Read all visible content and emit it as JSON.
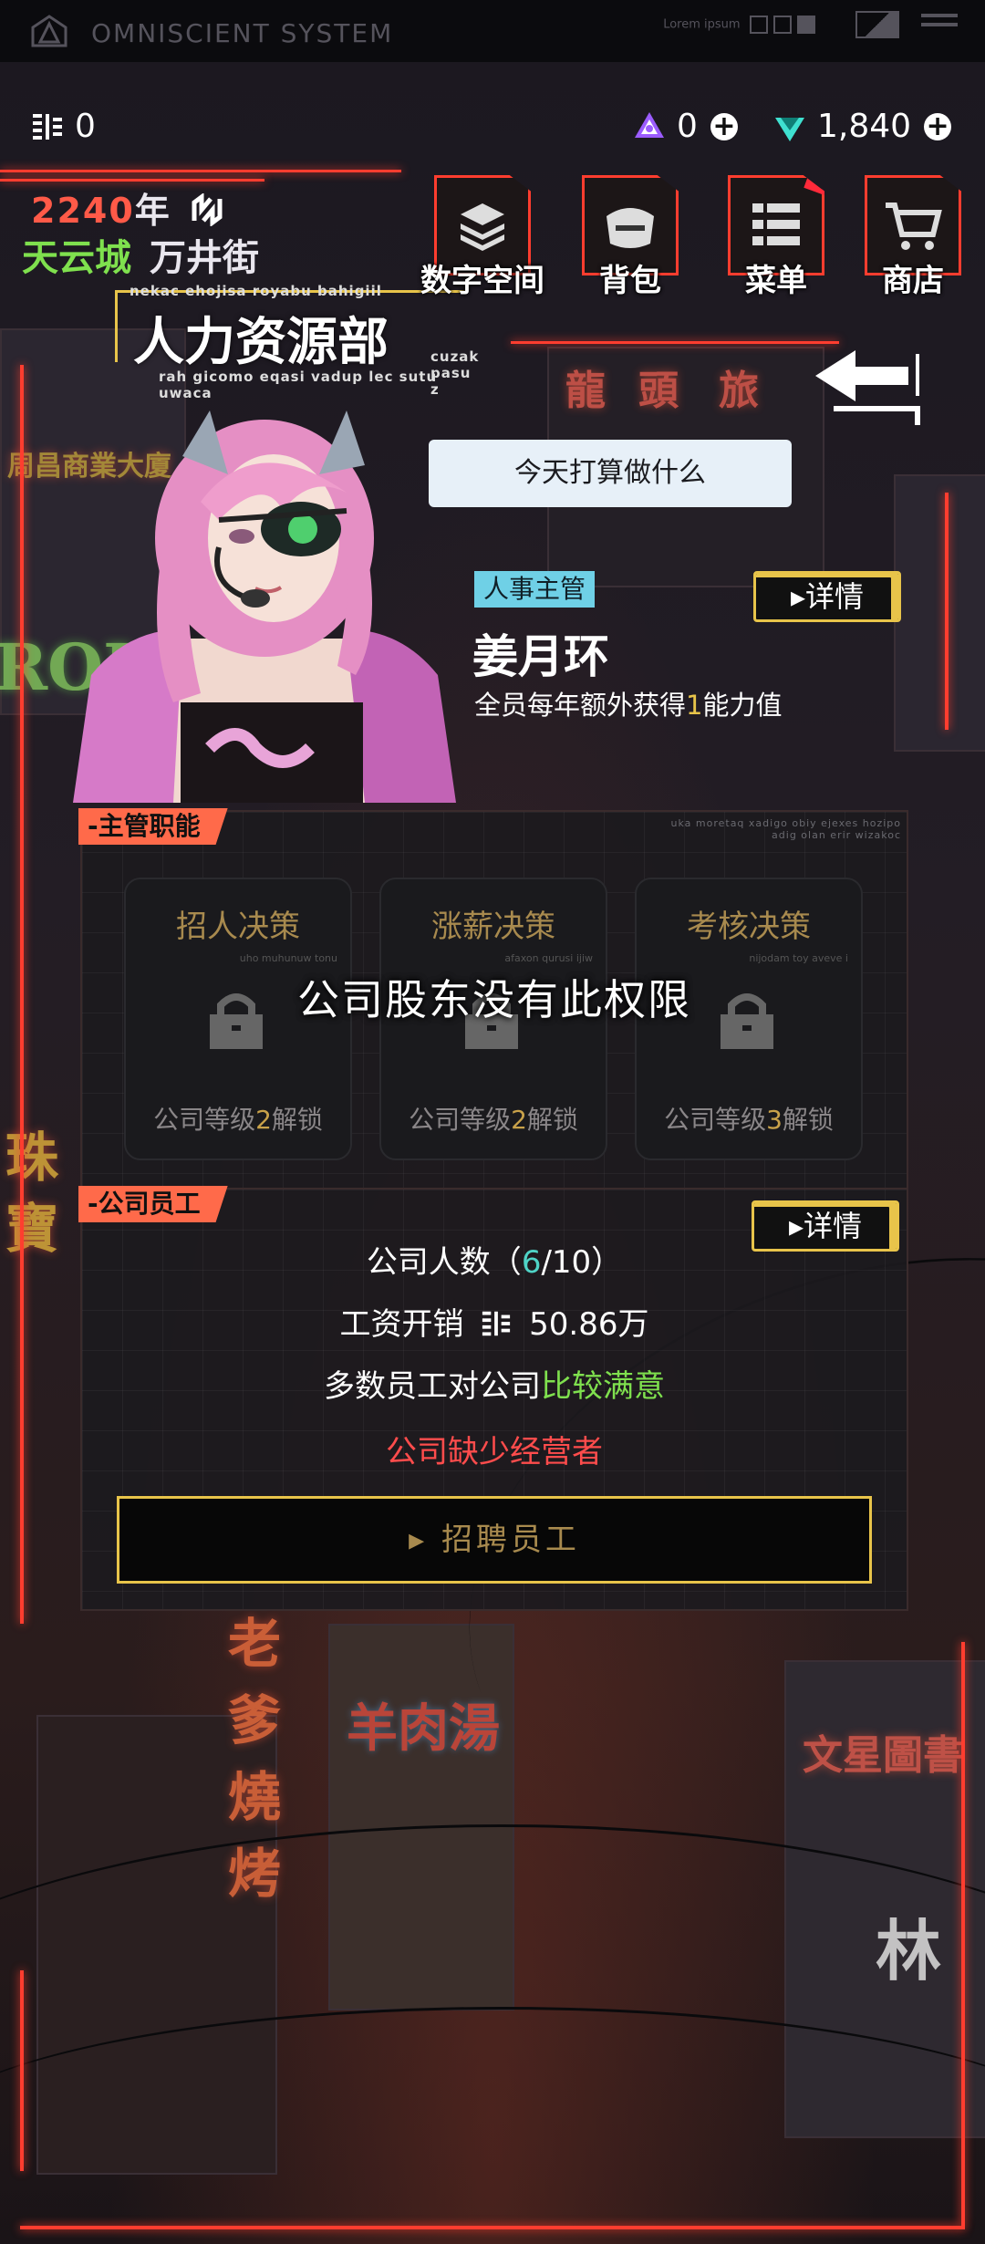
{
  "system": {
    "title": "OMNISCIENT SYSTEM",
    "lorem": "Lorem ipsum"
  },
  "currency": {
    "coins": "0",
    "crystals": "0",
    "gems": "1,840"
  },
  "header": {
    "year_num": "2240",
    "year_suffix": "年",
    "city": "天云城",
    "street": "万井街",
    "department": "人力资源部",
    "tiny_top": "nekac ehojisa royabu bahigiil",
    "tiny_right": "cuzak pasu z",
    "tiny_bottom": "rah gicomo eqasi vadup lec sutu uwaca"
  },
  "nav": [
    {
      "label": "数字空间",
      "icon": "layers-icon"
    },
    {
      "label": "背包",
      "icon": "bag-icon"
    },
    {
      "label": "菜单",
      "icon": "menu-icon"
    },
    {
      "label": "商店",
      "icon": "cart-icon"
    }
  ],
  "character": {
    "speech": "今天打算做什么",
    "role": "人事主管",
    "detail_label": "详情",
    "name": "姜月环",
    "desc_pre": "全员每年额外获得",
    "desc_num": "1",
    "desc_post": "能力值"
  },
  "supervisor_panel": {
    "tag": "主管职能",
    "tiny1": "uka moretaq xadigo obiy ejexes hozipo",
    "tiny2": "adig olan erir wizakoc",
    "no_permission": "公司股东没有此权限",
    "cards": [
      {
        "title": "招人决策",
        "sub": "uho muhunuw tonu",
        "unlock_pre": "公司等级",
        "level": "2",
        "unlock_post": "解锁"
      },
      {
        "title": "涨薪决策",
        "sub": "afaxon qurusi ijiw",
        "unlock_pre": "公司等级",
        "level": "2",
        "unlock_post": "解锁"
      },
      {
        "title": "考核决策",
        "sub": "nijodam toy aveve i",
        "unlock_pre": "公司等级",
        "level": "3",
        "unlock_post": "解锁"
      }
    ]
  },
  "staff_panel": {
    "tag": "公司员工",
    "detail_label": "详情",
    "count_label": "公司人数（",
    "count_now": "6",
    "count_max": "/10）",
    "salary_label": "工资开销",
    "salary_value": "50.86万",
    "satisfaction_pre": "多数员工对公司",
    "satisfaction_value": "比较满意",
    "warning": "公司缺少经营者",
    "hire_button": "招聘员工"
  },
  "neon_signs": {
    "s1": "龍",
    "s2": "頭",
    "s3": "旅",
    "s4": "周昌商業大廈",
    "s5": "ROLEX",
    "s6": "羊肉湯",
    "s7": "老爹燒烤",
    "s8": "文星圖書",
    "s9": "林",
    "s10": "珠寶"
  }
}
